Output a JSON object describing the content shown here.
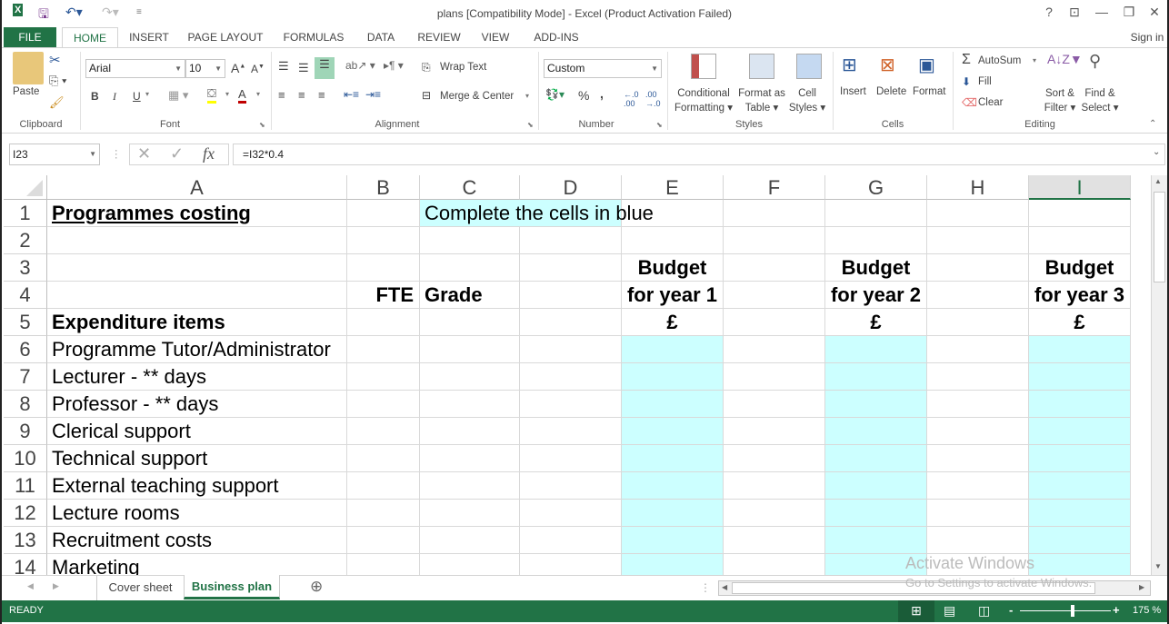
{
  "window": {
    "title": "plans  [Compatibility Mode] - Excel (Product Activation Failed)",
    "help": "?",
    "controls": [
      "ribbon-display",
      "minimize",
      "restore",
      "close"
    ],
    "sign_in": "Sign in"
  },
  "ribbon_tabs": [
    "FILE",
    "HOME",
    "INSERT",
    "PAGE LAYOUT",
    "FORMULAS",
    "DATA",
    "REVIEW",
    "VIEW",
    "ADD-INS"
  ],
  "active_tab": "HOME",
  "clipboard": {
    "paste": "Paste",
    "label": "Clipboard"
  },
  "font": {
    "name": "Arial",
    "size": "10",
    "bold": "B",
    "italic": "I",
    "underline": "U",
    "label": "Font",
    "grow": "A",
    "shrink": "A",
    "font_color_icon": "A",
    "fill_color": "#ffff00",
    "text_color": "#c00000"
  },
  "alignment": {
    "wrap_text": "Wrap Text",
    "merge_center": "Merge & Center",
    "label": "Alignment"
  },
  "number": {
    "format": "Custom",
    "percent": "%",
    "comma": ",",
    "inc_dec": "←.0 .00",
    "dec_dec": ".00 →.0",
    "label": "Number"
  },
  "styles": {
    "conditional": [
      "Conditional",
      "Formatting ▾"
    ],
    "format_table": [
      "Format as",
      "Table ▾"
    ],
    "cell_styles": [
      "Cell",
      "Styles ▾"
    ],
    "label": "Styles"
  },
  "cells": {
    "insert": "Insert",
    "delete": "Delete",
    "format": "Format",
    "label": "Cells"
  },
  "editing": {
    "autosum": "AutoSum",
    "fill": "Fill",
    "clear": "Clear",
    "sort": [
      "Sort &",
      "Filter ▾"
    ],
    "find": [
      "Find &",
      "Select ▾"
    ],
    "label": "Editing"
  },
  "formula_bar": {
    "name_box": "I23",
    "cancel": "✕",
    "enter": "✓",
    "fx": "fx",
    "formula": "=I32*0.4"
  },
  "columns": [
    "A",
    "B",
    "C",
    "D",
    "E",
    "F",
    "G",
    "H",
    "I"
  ],
  "selected_column": "I",
  "rows": [
    "1",
    "2",
    "3",
    "4",
    "5",
    "6",
    "7",
    "8",
    "9",
    "10",
    "11",
    "12",
    "13",
    "14"
  ],
  "cells_data": {
    "A1": "Programmes costing",
    "C1": "Complete the cells in blue",
    "E3": "Budget",
    "G3": "Budget",
    "I3": "Budget",
    "B4": "FTE",
    "C4": "Grade",
    "E4": "for year 1",
    "G4": "for year 2",
    "I4": "for year 3",
    "A5": "Expenditure items",
    "E5": "£",
    "G5": "£",
    "I5": "£",
    "A6": "Programme Tutor/Administrator",
    "A7": "Lecturer - ** days",
    "A8": "Professor - ** days",
    "A9": "Clerical support",
    "A10": "Technical support",
    "A11": "External teaching support",
    "A12": "Lecture rooms",
    "A13": "Recruitment costs",
    "A14": "Marketing"
  },
  "input_fill_color": "#ccffff",
  "sheets": [
    "Cover sheet",
    "Business plan"
  ],
  "active_sheet": "Business plan",
  "add_sheet": "⊕",
  "status": {
    "mode": "READY",
    "zoom": "175 %",
    "zoom_fraction": 0.58
  },
  "watermark": {
    "line1": "Activate Windows",
    "line2": "Go to Settings to activate Windows."
  }
}
